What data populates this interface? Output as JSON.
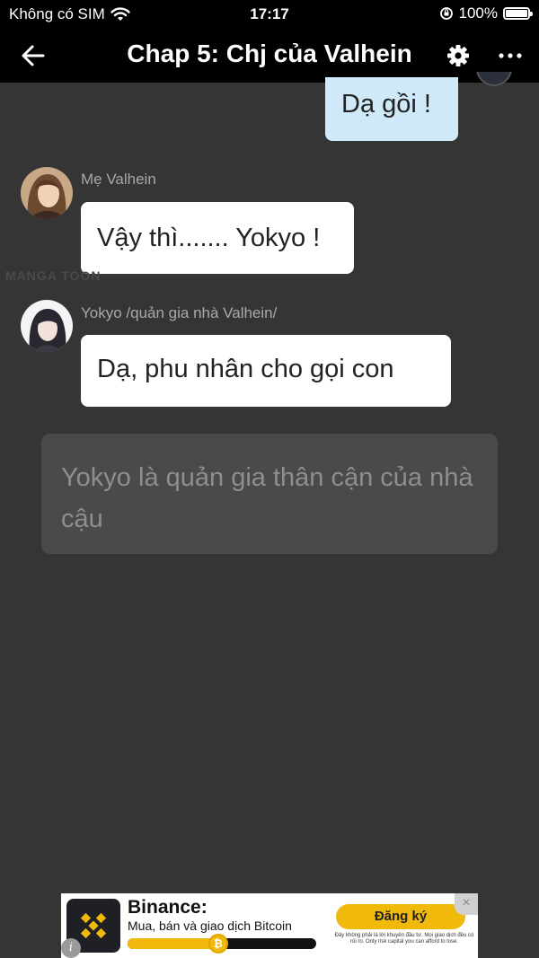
{
  "status_bar": {
    "carrier": "Không có SIM",
    "time": "17:17",
    "battery": "100%"
  },
  "nav": {
    "title": "Chap 5: Chj của Valhein",
    "icons": [
      "back-arrow-icon",
      "gear-icon",
      "more-icon"
    ]
  },
  "messages": [
    {
      "type": "self",
      "text": "Dạ gồi !"
    },
    {
      "type": "other",
      "sender": "Mẹ Valhein",
      "text": "Vậy thì....... Yokyo !"
    },
    {
      "type": "other",
      "sender": "Yokyo /quản gia nhà Valhein/",
      "text": "Dạ, phu nhân cho gọi con"
    },
    {
      "type": "narration",
      "text": "Yokyo là quản gia thân cận của nhà cậu"
    }
  ],
  "watermark": "MANGA TOON",
  "ad": {
    "brand": "Binance:",
    "description": "Mua, bán và giao dịch Bitcoin",
    "cta": "Đăng ký",
    "disclaimer": "Đây không phải là lời khuyên đầu tư. Mọi giao dịch đều có rủi ro. Only risk capital you can afford to lose.",
    "progress": 0.48,
    "close": "×",
    "info": "i"
  },
  "colors": {
    "background": "#353535",
    "bar": "#000000",
    "self_bubble": "#cfe9f8",
    "other_bubble": "#ffffff",
    "binance_yellow": "#f0b90b"
  }
}
